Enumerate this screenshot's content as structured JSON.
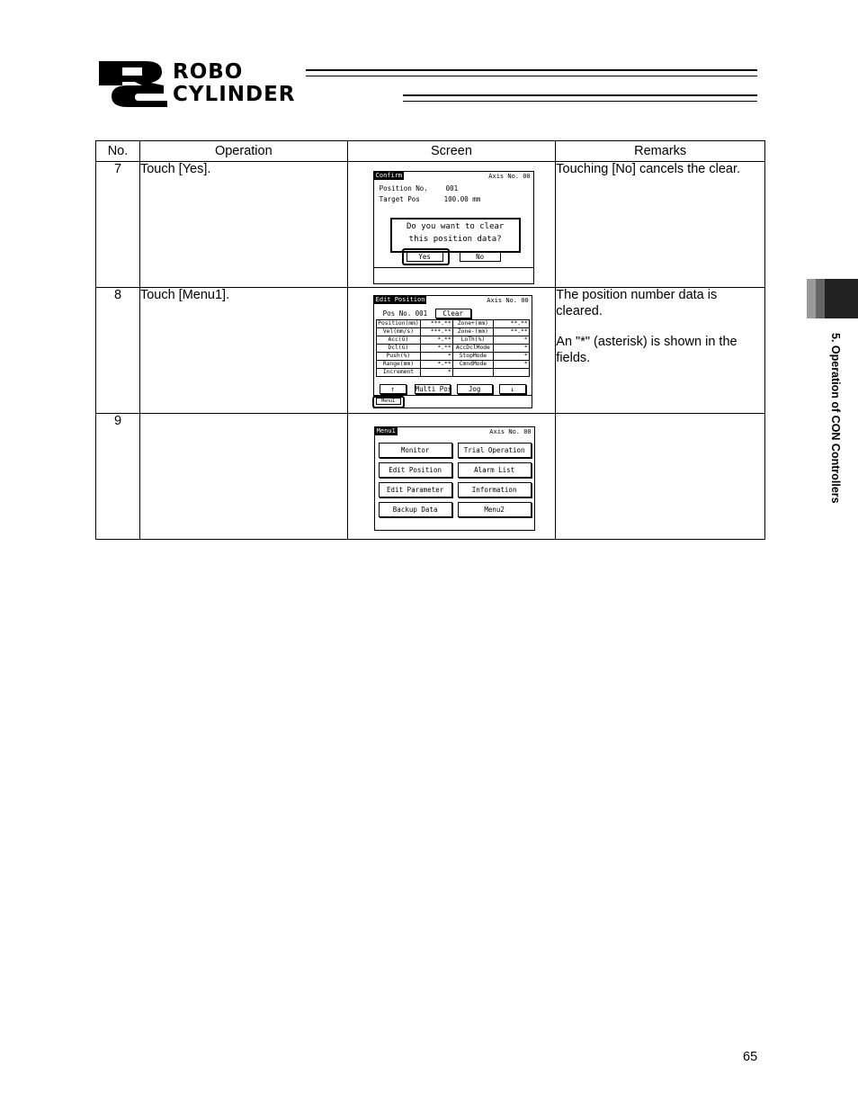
{
  "header": {
    "logo_word1": "ROBO",
    "logo_word2": "CYLINDER"
  },
  "side_tab": {
    "label": "5. Operation of CON Controllers"
  },
  "table": {
    "headers": [
      "No.",
      "Operation",
      "Screen",
      "Remarks"
    ],
    "rows": [
      {
        "no": "7",
        "operation": "Touch [Yes].",
        "remarks": [
          "Touching [No] cancels the clear."
        ]
      },
      {
        "no": "8",
        "operation": "Touch [Menu1].",
        "remarks": [
          "The position number data is cleared.",
          "An \"*\" (asterisk) is shown in the fields."
        ]
      },
      {
        "no": "9",
        "operation": "",
        "remarks": []
      }
    ]
  },
  "screens": {
    "confirm": {
      "title": "Confirm",
      "axis": "Axis No. 00",
      "position_label": "Position No.",
      "position_value": "001",
      "target_label": "Target Pos",
      "target_value": "100.00 mm",
      "msg_line1": "Do you want to clear",
      "msg_line2": "this position data?",
      "yes": "Yes",
      "no": "No"
    },
    "edit": {
      "title": "Edit Position",
      "axis": "Axis No. 00",
      "pos_label": "Pos No.",
      "pos_value": "001",
      "clear": "Clear",
      "rows": [
        [
          "Position(mm)",
          "***.**",
          "Zone+(mm)",
          "**.**"
        ],
        [
          "Vel(mm/s)",
          "***.**",
          "Zone-(mm)",
          "**.**"
        ],
        [
          "Acc(G)",
          "*.**",
          "LoTh(%)",
          "*"
        ],
        [
          "Dcl(G)",
          "*.**",
          "AccDclMode",
          "*"
        ],
        [
          "Push(%)",
          "*",
          "StopMode",
          "*"
        ],
        [
          "Range(mm)",
          "*.**",
          "CmndMode",
          "*"
        ],
        [
          "Increment",
          "*",
          "",
          ""
        ]
      ],
      "up": "↑",
      "multi": "Multi Pos",
      "jog": "Jog",
      "down": "↓",
      "menu": "Menu1"
    },
    "menu1": {
      "title": "Menu1",
      "axis": "Axis No. 00",
      "buttons": [
        "Monitor",
        "Trial Operation",
        "Edit Position",
        "Alarm List",
        "Edit Parameter",
        "Information",
        "Backup Data",
        "Menu2"
      ]
    }
  },
  "page_number": "65"
}
